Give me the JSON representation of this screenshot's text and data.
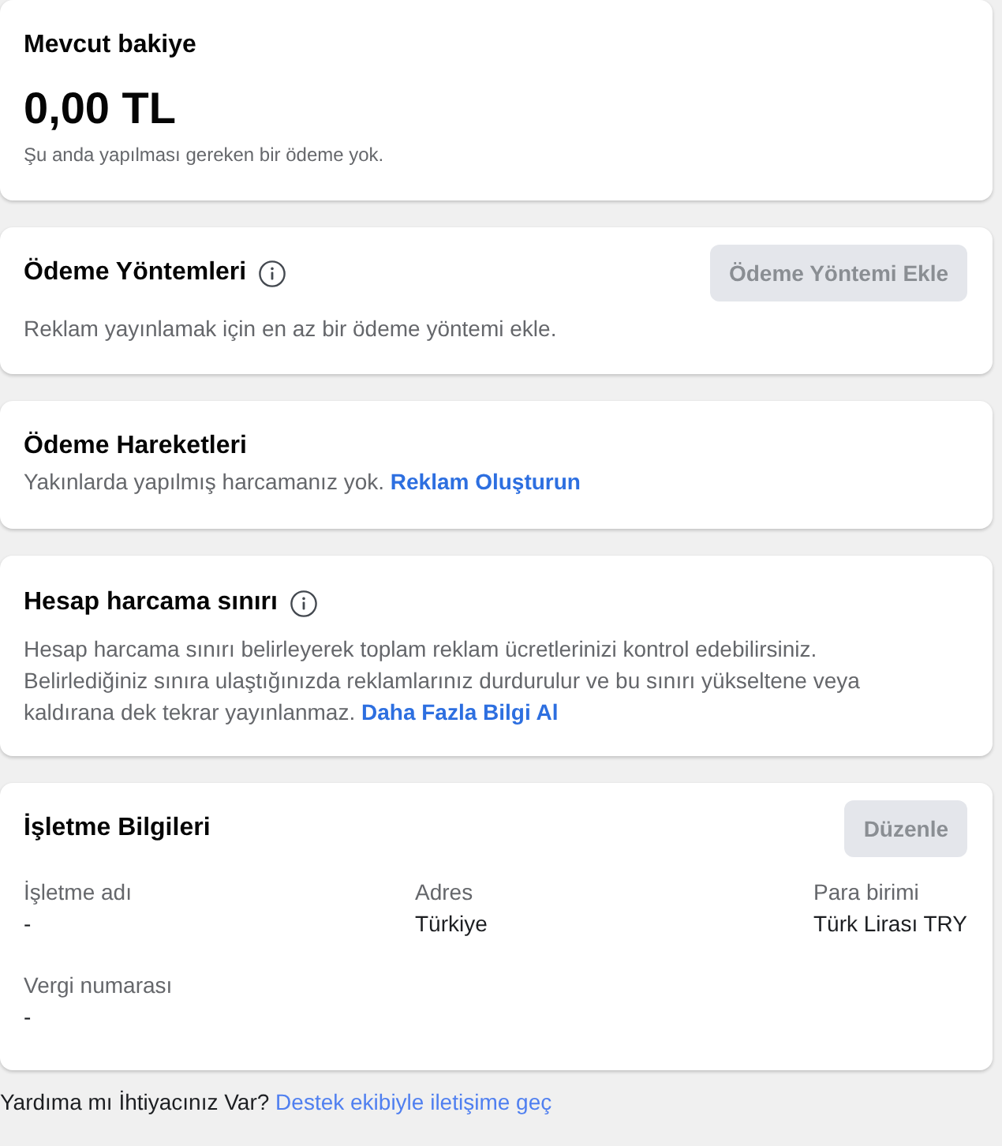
{
  "balance": {
    "title": "Mevcut bakiye",
    "amount": "0,00 TL",
    "note": "Şu anda yapılması gereken bir ödeme yok."
  },
  "payment_methods": {
    "title": "Ödeme Yöntemleri",
    "button": {
      "label": "Ödeme Yöntemi Ekle",
      "disabled": true
    },
    "description": "Reklam yayınlamak için en az bir ödeme yöntemi ekle."
  },
  "payment_activity": {
    "title": "Ödeme Hareketleri",
    "text": "Yakınlarda yapılmış harcamanız yok.",
    "link": "Reklam Oluşturun"
  },
  "spending_limit": {
    "title": "Hesap harcama sınırı",
    "text": "Hesap harcama sınırı belirleyerek toplam reklam ücretlerinizi kontrol edebilirsiniz. Belirlediğiniz sınıra ulaştığınızda reklamlarınız durdurulur ve bu sınırı yükseltene veya kaldırana dek tekrar yayınlanmaz.",
    "link": "Daha Fazla Bilgi Al"
  },
  "business_info": {
    "title": "İşletme Bilgileri",
    "button": {
      "label": "Düzenle",
      "disabled": true
    },
    "fields": [
      {
        "label": "İşletme adı",
        "value": "-"
      },
      {
        "label": "Adres",
        "value": "Türkiye"
      },
      {
        "label": "Para birimi",
        "value": "Türk Lirası TRY"
      },
      {
        "label": "Vergi numarası",
        "value": "-"
      }
    ]
  },
  "footer": {
    "text": "Yardıma mı İhtiyacınız Var?",
    "link": "Destek ekibiyle iletişime geç"
  }
}
